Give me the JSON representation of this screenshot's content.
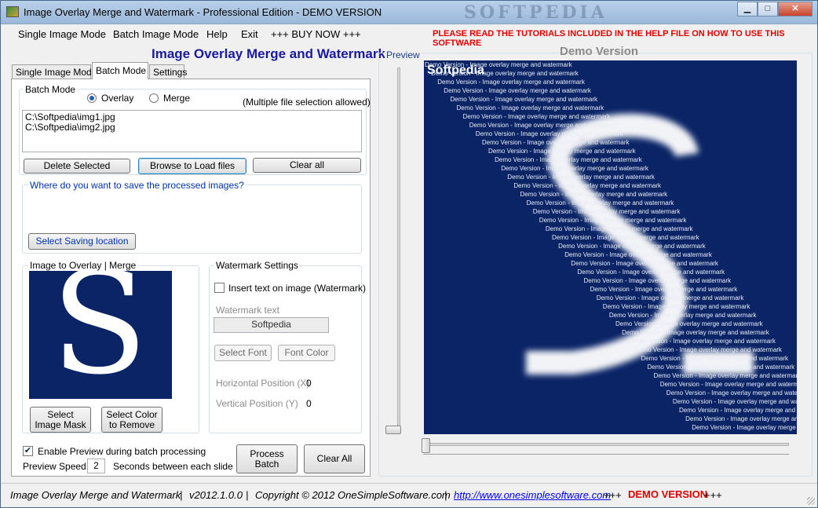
{
  "window": {
    "title": "Image Overlay Merge and Watermark - Professional Edition - DEMO VERSION",
    "bg_watermark": "SOFTPEDIA",
    "controls": {
      "minimize": "▁",
      "maximize": "□",
      "close": "✕"
    }
  },
  "menu": {
    "items": [
      "Single Image Mode",
      "Batch Image Mode",
      "Help",
      "Exit",
      "+++ BUY NOW +++"
    ],
    "notice": "PLEASE READ THE TUTORIALS INCLUDED IN THE HELP FILE ON HOW TO USE THIS SOFTWARE"
  },
  "heading": "Image Overlay Merge and Watermark",
  "tabs": [
    "Single Image Mode",
    "Batch Mode",
    "Settings"
  ],
  "batch_mode": {
    "group_label": "Batch Mode",
    "radio_overlay": "Overlay",
    "radio_merge": "Merge",
    "hint": "(Multiple file selection allowed)",
    "files": [
      "C:\\Softpedia\\img1.jpg",
      "C:\\Softpedia\\img2.jpg"
    ],
    "delete_btn": "Delete Selected",
    "browse_btn": "Browse to Load files",
    "clear_btn": "Clear all"
  },
  "save": {
    "prompt": "Where do you want to save the processed images?",
    "select_btn": "Select Saving location"
  },
  "overlay": {
    "group_label": "Image to Overlay | Merge",
    "image_letter": "S",
    "mask_btn": "Select Image Mask",
    "color_btn": "Select Color to Remove"
  },
  "watermark": {
    "group_label": "Watermark Settings",
    "insert_label": "Insert text on image (Watermark)",
    "text_label": "Watermark text",
    "text_value": "Softpedia",
    "font_btn": "Select Font",
    "color_btn": "Font Color",
    "hpos_label": "Horizontal Position (X)",
    "hpos_value": "0",
    "vpos_label": "Vertical Position (Y)",
    "vpos_value": "0"
  },
  "bottom": {
    "enable_preview": "Enable Preview during batch processing",
    "speed_label": "Preview Speed",
    "speed_value": "2",
    "speed_suffix": "Seconds between each slide",
    "process_btn": "Process Batch",
    "clear_btn": "Clear All"
  },
  "preview": {
    "label": "Preview",
    "title": "Demo Version",
    "softpedia": "Softpedia",
    "watermark_line": "Demo Version - Image overlay merge and watermark"
  },
  "status": {
    "app": "Image Overlay Merge and Watermark",
    "version": "v2012.1.0.0",
    "copyright": "Copyright © 2012 OneSimpleSoftware.com",
    "url": "http://www.onesimplesoftware.com",
    "plus": "+++",
    "demo": "DEMO VERSION",
    "sep": "|"
  },
  "colors": {
    "accent": "#1a1aa0",
    "notice": "#e00000",
    "image_bg": "#0a2466"
  }
}
